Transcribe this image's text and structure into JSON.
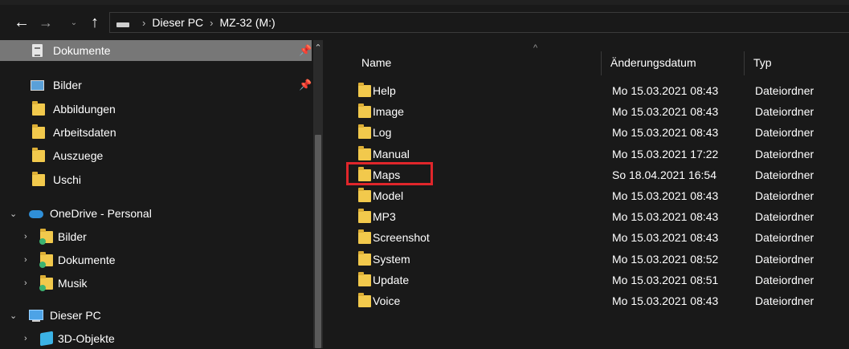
{
  "nav": {
    "back_icon": "←",
    "forward_icon": "→",
    "recent_icon": "⌄",
    "up_icon": "↑"
  },
  "address": {
    "crumbs": [
      "Dieser PC",
      "MZ-32 (M:)"
    ],
    "separator": "›"
  },
  "sidebar": {
    "scroll_up_icon": "⌃",
    "pin_icon": "📌",
    "items": [
      {
        "label": "Dokumente"
      },
      {
        "label": "Bilder"
      },
      {
        "label": "Abbildungen"
      },
      {
        "label": "Arbeitsdaten"
      },
      {
        "label": "Auszuege"
      },
      {
        "label": "Uschi"
      },
      {
        "label": "OneDrive - Personal"
      },
      {
        "label": "Bilder"
      },
      {
        "label": "Dokumente"
      },
      {
        "label": "Musik"
      },
      {
        "label": "Dieser PC"
      },
      {
        "label": "3D-Objekte"
      }
    ],
    "chevron_collapsed": "›",
    "chevron_expanded": "⌄"
  },
  "columns": {
    "name": "Name",
    "date": "Änderungsdatum",
    "type": "Typ",
    "sort_caret": "^"
  },
  "files": [
    {
      "name": "Help",
      "date": "Mo 15.03.2021 08:43",
      "type": "Dateiordner"
    },
    {
      "name": "Image",
      "date": "Mo 15.03.2021 08:43",
      "type": "Dateiordner"
    },
    {
      "name": "Log",
      "date": "Mo 15.03.2021 08:43",
      "type": "Dateiordner"
    },
    {
      "name": "Manual",
      "date": "Mo 15.03.2021 17:22",
      "type": "Dateiordner"
    },
    {
      "name": "Maps",
      "date": "So 18.04.2021 16:54",
      "type": "Dateiordner"
    },
    {
      "name": "Model",
      "date": "Mo 15.03.2021 08:43",
      "type": "Dateiordner"
    },
    {
      "name": "MP3",
      "date": "Mo 15.03.2021 08:43",
      "type": "Dateiordner"
    },
    {
      "name": "Screenshot",
      "date": "Mo 15.03.2021 08:43",
      "type": "Dateiordner"
    },
    {
      "name": "System",
      "date": "Mo 15.03.2021 08:52",
      "type": "Dateiordner"
    },
    {
      "name": "Update",
      "date": "Mo 15.03.2021 08:51",
      "type": "Dateiordner"
    },
    {
      "name": "Voice",
      "date": "Mo 15.03.2021 08:43",
      "type": "Dateiordner"
    }
  ],
  "colors": {
    "background": "#191919",
    "selected": "#777777",
    "folder": "#f2c94c",
    "highlight_box": "#e0262b"
  }
}
